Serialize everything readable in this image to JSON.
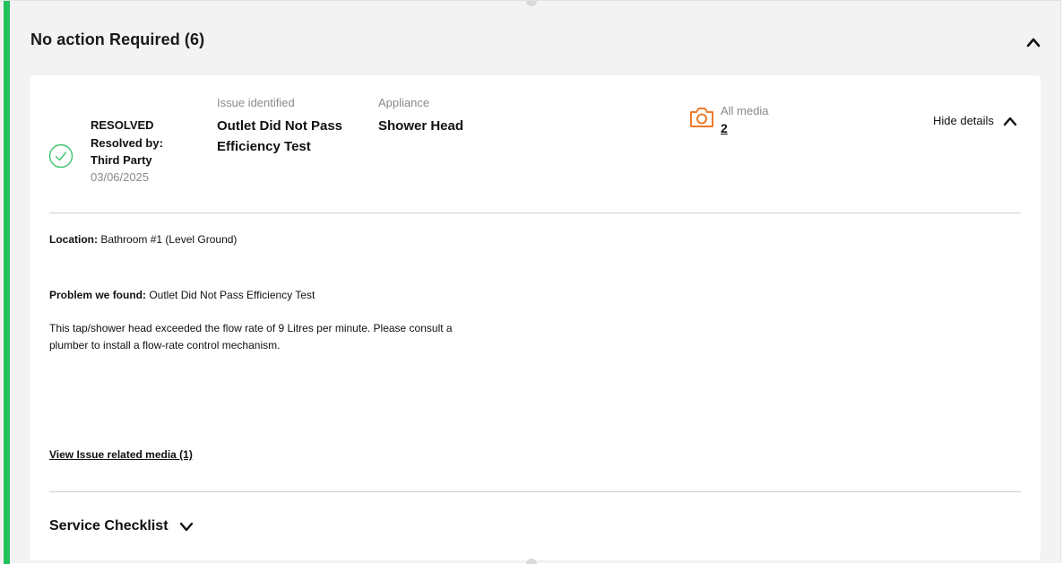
{
  "section": {
    "title": "No action Required (6)"
  },
  "issue": {
    "status": "RESOLVED",
    "resolved_by_label": "Resolved by:",
    "resolved_by": "Third Party",
    "date": "03/06/2025",
    "issue_label": "Issue identified",
    "issue_value_line1": "Outlet Did Not Pass",
    "issue_value_line2": "Efficiency Test",
    "appliance_label": "Appliance",
    "appliance_value": "Shower Head",
    "media_label": "All media",
    "media_count": "2",
    "hide_details": "Hide details"
  },
  "details": {
    "location_label": "Location:",
    "location_value": "Bathroom #1 (Level Ground)",
    "problem_label": "Problem we found:",
    "problem_value": "Outlet Did Not Pass Efficiency Test",
    "description_line1": "This tap/shower head exceeded the flow rate of 9 Litres per minute. Please consult a",
    "description_line2": "plumber to install a flow-rate control mechanism.",
    "media_link": "View Issue related media (1)"
  },
  "checklist": {
    "label": "Service Checklist"
  },
  "icons": {
    "status": "check-circle-icon",
    "media": "camera-icon",
    "collapse": "chevron-up-icon",
    "hide": "chevron-up-icon",
    "checklist": "chevron-down-icon"
  },
  "colors": {
    "accent": "#21c15b",
    "resolved_icon": "#3cc46e",
    "camera": "#f07a2a",
    "panel_bg": "#f3f3f3"
  }
}
